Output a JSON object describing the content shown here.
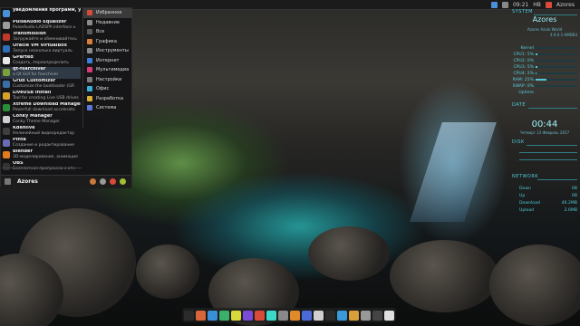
{
  "top_panel": {
    "clock": "09:21",
    "status": "HB",
    "user": "Azores"
  },
  "app_menu": {
    "apps": [
      {
        "name": "уведомления программ, уста",
        "desc": "",
        "color": "#4a90d9",
        "icon": "notification-icon"
      },
      {
        "name": "PulseAudio Equalizer",
        "desc": "PulseAudio LADSPA interface u",
        "color": "#9c9c9c",
        "icon": "equalizer-icon"
      },
      {
        "name": "Transmission",
        "desc": "Загружайте и обменивайтесь",
        "color": "#c0392b",
        "icon": "transmission-icon"
      },
      {
        "name": "Oracle VM VirtualBox",
        "desc": "Запуск несколько виртуаль",
        "color": "#2f6fb5",
        "icon": "virtualbox-icon"
      },
      {
        "name": "GParted",
        "desc": "Создать, переопределить",
        "color": "#e8e8e8",
        "icon": "gparted-icon"
      },
      {
        "name": "qt-fsarchiver",
        "desc": "a Qt GUI for fsarchiver",
        "color": "#7aa23a",
        "icon": "fsarchiver-icon"
      },
      {
        "name": "Grub Customizer",
        "desc": "Customize the bootloader (GR",
        "color": "#3a6ea5",
        "icon": "grub-icon"
      },
      {
        "name": "LiveUSB Install",
        "desc": "Tool for creating Live USB drives",
        "color": "#d9a22b",
        "icon": "usb-icon"
      },
      {
        "name": "Xtreme Download Manager",
        "desc": "Powerfull download accelerato",
        "color": "#2a8f3a",
        "icon": "download-manager-icon"
      },
      {
        "name": "Conky Manager",
        "desc": "Conky Theme Manager",
        "color": "#cfcfcf",
        "icon": "conky-icon"
      },
      {
        "name": "Kdenlive",
        "desc": "Нелинейный видеоредактор",
        "color": "#3e3e3e",
        "icon": "kdenlive-icon"
      },
      {
        "name": "Pinta",
        "desc": "Создание и редактирование",
        "color": "#6b6bb5",
        "icon": "pinta-icon"
      },
      {
        "name": "Blender",
        "desc": "3D-моделирование, анимация",
        "color": "#e07b20",
        "icon": "blender-icon"
      },
      {
        "name": "OBS",
        "desc": "Бесплатная программа с отк",
        "color": "#333333",
        "icon": "obs-icon"
      }
    ],
    "categories": [
      {
        "label": "Избранное",
        "color": "#d94a3a"
      },
      {
        "label": "Недавние",
        "color": "#8a8a8a"
      },
      {
        "label": "Все",
        "color": "#5a5a5a"
      },
      {
        "label": "Графика",
        "color": "#d97f3a"
      },
      {
        "label": "Инструменты",
        "color": "#8a8a8a"
      },
      {
        "label": "Интернет",
        "color": "#3a7fd9"
      },
      {
        "label": "Мультимедиа",
        "color": "#d93a7a"
      },
      {
        "label": "Настройки",
        "color": "#7a7a7a"
      },
      {
        "label": "Офис",
        "color": "#3ab0d9"
      },
      {
        "label": "Разработка",
        "color": "#d9b03a"
      },
      {
        "label": "Система",
        "color": "#5a7ad9"
      }
    ],
    "user_name": "Azores"
  },
  "conky": {
    "system_label": "SYSTEM",
    "hostname": "Azores",
    "subtitle": "Azores Azulo World",
    "kernel": "4.9.0-1-AMD64",
    "rows": [
      {
        "label": "Kernel",
        "value": 0
      },
      {
        "label": "CPU1: 5%",
        "value": 0.05
      },
      {
        "label": "CPU2: 0%",
        "value": 0.0
      },
      {
        "label": "CPU3: 5%",
        "value": 0.05
      },
      {
        "label": "CPU4: 2%",
        "value": 0.02
      },
      {
        "label": "RAM: 25%",
        "value": 0.25
      },
      {
        "label": "SWAP: 0%",
        "value": 0.0
      }
    ],
    "uptime_label": "Uptime",
    "date_label": "DATE",
    "time": "00:44",
    "date": "Четверг 13 Февраль 2017",
    "disk_label": "DISK",
    "net_label": "NETWORK",
    "net": [
      {
        "label": "Down",
        "value": "0B"
      },
      {
        "label": "Up",
        "value": "0B"
      },
      {
        "label": "Download",
        "value": "46.2MB"
      },
      {
        "label": "Upload",
        "value": "2.6MB"
      }
    ]
  }
}
